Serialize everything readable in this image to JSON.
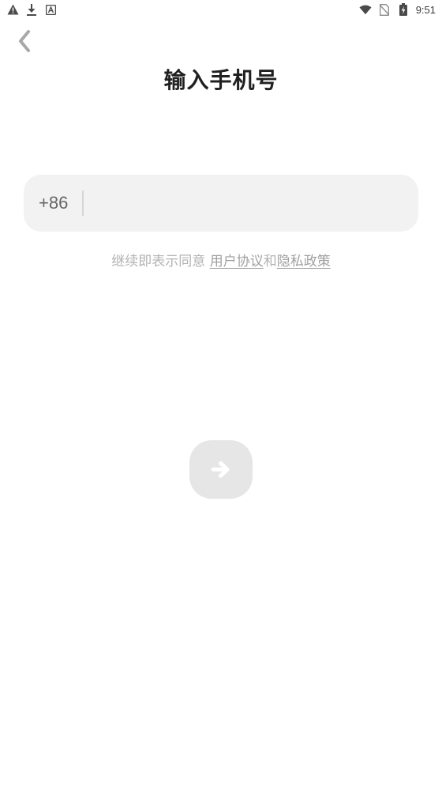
{
  "status_bar": {
    "time": "9:51",
    "left_icons": [
      "warning-icon",
      "download-icon",
      "app-a-icon"
    ],
    "right_icons": [
      "wifi-icon",
      "no-sim-icon",
      "battery-charging-icon"
    ]
  },
  "header": {
    "title": "输入手机号"
  },
  "phone": {
    "country_code": "+86",
    "value": "",
    "placeholder": ""
  },
  "agreement": {
    "prefix": "继续即表示同意",
    "user_agreement": "用户协议",
    "conjunction": "和",
    "privacy_policy": "隐私政策"
  },
  "colors": {
    "field_bg": "#f2f2f2",
    "button_bg": "#e6e6e6",
    "muted_text": "#b3b3b3"
  }
}
